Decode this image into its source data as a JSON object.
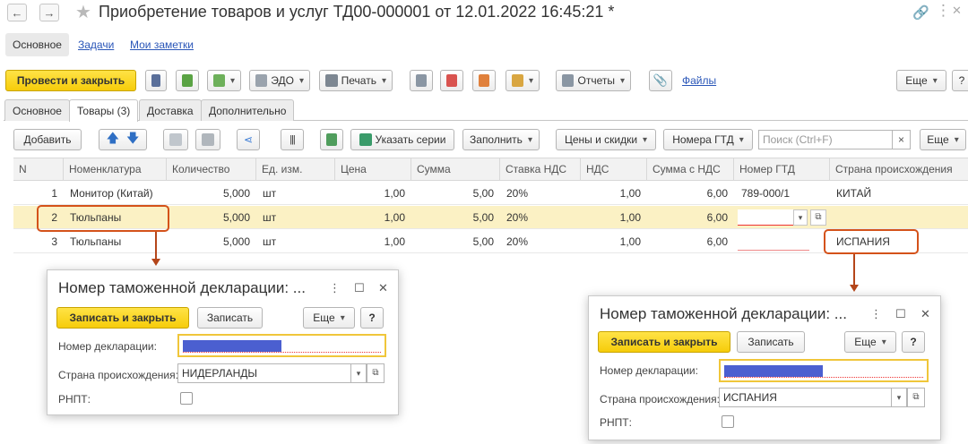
{
  "window": {
    "title": "Приобретение товаров и услуг ТД00-000001 от 12.01.2022 16:45:21 *"
  },
  "subnav": {
    "main": "Основное",
    "tasks": "Задачи",
    "notes": "Мои заметки"
  },
  "toolbar": {
    "post_close": "Провести и закрыть",
    "edo": "ЭДО",
    "print": "Печать",
    "reports": "Отчеты",
    "files": "Файлы",
    "more": "Еще"
  },
  "tabs": [
    "Основное",
    "Товары (3)",
    "Доставка",
    "Дополнительно"
  ],
  "table_toolbar": {
    "add": "Добавить",
    "series": "Указать серии",
    "fill": "Заполнить",
    "prices": "Цены и скидки",
    "gtd_numbers": "Номера ГТД",
    "search_placeholder": "Поиск (Ctrl+F)",
    "clear": "×",
    "more": "Еще"
  },
  "table": {
    "columns": [
      "N",
      "Номенклатура",
      "Количество",
      "Ед. изм.",
      "Цена",
      "Сумма",
      "Ставка НДС",
      "НДС",
      "Сумма с НДС",
      "Номер ГТД",
      "Страна происхождения"
    ],
    "rows": [
      {
        "n": "1",
        "item": "Монитор (Китай)",
        "qty": "5,000",
        "unit": "шт",
        "price": "1,00",
        "sum": "5,00",
        "vat_rate": "20%",
        "vat": "1,00",
        "total": "6,00",
        "gtd": "789-000/1",
        "country": "КИТАЙ"
      },
      {
        "n": "2",
        "item": "Тюльпаны",
        "qty": "5,000",
        "unit": "шт",
        "price": "1,00",
        "sum": "5,00",
        "vat_rate": "20%",
        "vat": "1,00",
        "total": "6,00",
        "gtd": "",
        "country": ""
      },
      {
        "n": "3",
        "item": "Тюльпаны",
        "qty": "5,000",
        "unit": "шт",
        "price": "1,00",
        "sum": "5,00",
        "vat_rate": "20%",
        "vat": "1,00",
        "total": "6,00",
        "gtd": "",
        "country": "ИСПАНИЯ"
      }
    ]
  },
  "dialog_left": {
    "title": "Номер таможенной декларации: ...",
    "save_close": "Записать и закрыть",
    "save": "Записать",
    "more": "Еще",
    "help": "?",
    "decl_label": "Номер декларации:",
    "country_label": "Страна происхождения:",
    "country_value": "НИДЕРЛАНДЫ",
    "rnpt_label": "РНПТ:"
  },
  "dialog_right": {
    "title": "Номер таможенной декларации: ...",
    "save_close": "Записать и закрыть",
    "save": "Записать",
    "more": "Еще",
    "help": "?",
    "decl_label": "Номер декларации:",
    "country_label": "Страна происхождения:",
    "country_value": "ИСПАНИЯ",
    "rnpt_label": "РНПТ:"
  },
  "colors": {
    "accent_yellow": "#f6cc0a",
    "link_blue": "#2a56b8",
    "selected_row": "#fbf1c4",
    "callout": "#d4521a",
    "redacted_fill": "#4b5fd0"
  }
}
